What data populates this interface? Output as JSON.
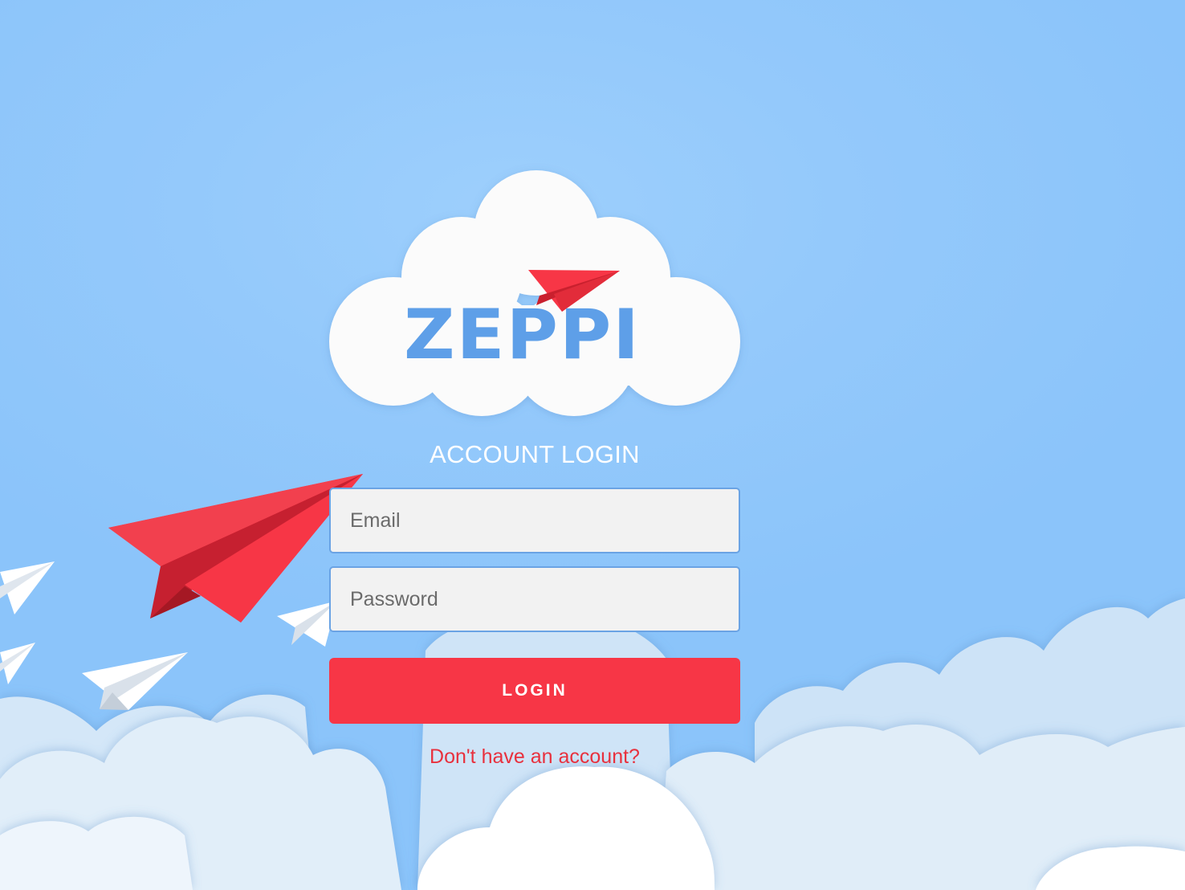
{
  "logo": {
    "text": "ZEPPI",
    "icon": "paper-plane-icon"
  },
  "form": {
    "title": "ACCOUNT LOGIN",
    "email_placeholder": "Email",
    "password_placeholder": "Password",
    "login_label": "LOGIN",
    "signup_link": "Don't have an account?"
  },
  "colors": {
    "sky": "#94c9fb",
    "logo_blue": "#5e9fe8",
    "accent_red": "#f73646",
    "field_bg": "#f2f2f2",
    "field_border": "#6aa3e4"
  }
}
